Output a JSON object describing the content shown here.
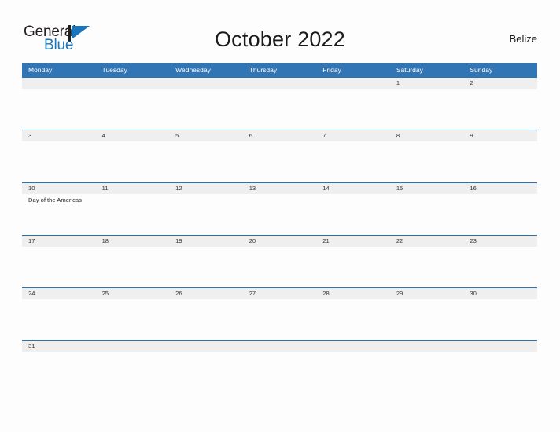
{
  "header": {
    "logo": {
      "word_one": "General",
      "word_two": "Blue",
      "flag_icon": "blue-flag-triangle-icon",
      "word_one_color": "#231f20",
      "word_two_color": "#1b75bb"
    },
    "title": "October 2022",
    "region": "Belize"
  },
  "calendar": {
    "accent_color": "#3275b5",
    "border_color": "#2e72ad",
    "date_band_color": "#efefef",
    "weekdays": [
      "Monday",
      "Tuesday",
      "Wednesday",
      "Thursday",
      "Friday",
      "Saturday",
      "Sunday"
    ],
    "weeks": [
      {
        "days": [
          {
            "date": "",
            "event": ""
          },
          {
            "date": "",
            "event": ""
          },
          {
            "date": "",
            "event": ""
          },
          {
            "date": "",
            "event": ""
          },
          {
            "date": "",
            "event": ""
          },
          {
            "date": "1",
            "event": ""
          },
          {
            "date": "2",
            "event": ""
          }
        ]
      },
      {
        "days": [
          {
            "date": "3",
            "event": ""
          },
          {
            "date": "4",
            "event": ""
          },
          {
            "date": "5",
            "event": ""
          },
          {
            "date": "6",
            "event": ""
          },
          {
            "date": "7",
            "event": ""
          },
          {
            "date": "8",
            "event": ""
          },
          {
            "date": "9",
            "event": ""
          }
        ]
      },
      {
        "days": [
          {
            "date": "10",
            "event": "Day of the Americas"
          },
          {
            "date": "11",
            "event": ""
          },
          {
            "date": "12",
            "event": ""
          },
          {
            "date": "13",
            "event": ""
          },
          {
            "date": "14",
            "event": ""
          },
          {
            "date": "15",
            "event": ""
          },
          {
            "date": "16",
            "event": ""
          }
        ]
      },
      {
        "days": [
          {
            "date": "17",
            "event": ""
          },
          {
            "date": "18",
            "event": ""
          },
          {
            "date": "19",
            "event": ""
          },
          {
            "date": "20",
            "event": ""
          },
          {
            "date": "21",
            "event": ""
          },
          {
            "date": "22",
            "event": ""
          },
          {
            "date": "23",
            "event": ""
          }
        ]
      },
      {
        "days": [
          {
            "date": "24",
            "event": ""
          },
          {
            "date": "25",
            "event": ""
          },
          {
            "date": "26",
            "event": ""
          },
          {
            "date": "27",
            "event": ""
          },
          {
            "date": "28",
            "event": ""
          },
          {
            "date": "29",
            "event": ""
          },
          {
            "date": "30",
            "event": ""
          }
        ]
      },
      {
        "days": [
          {
            "date": "31",
            "event": ""
          },
          {
            "date": "",
            "event": ""
          },
          {
            "date": "",
            "event": ""
          },
          {
            "date": "",
            "event": ""
          },
          {
            "date": "",
            "event": ""
          },
          {
            "date": "",
            "event": ""
          },
          {
            "date": "",
            "event": ""
          }
        ]
      }
    ]
  }
}
